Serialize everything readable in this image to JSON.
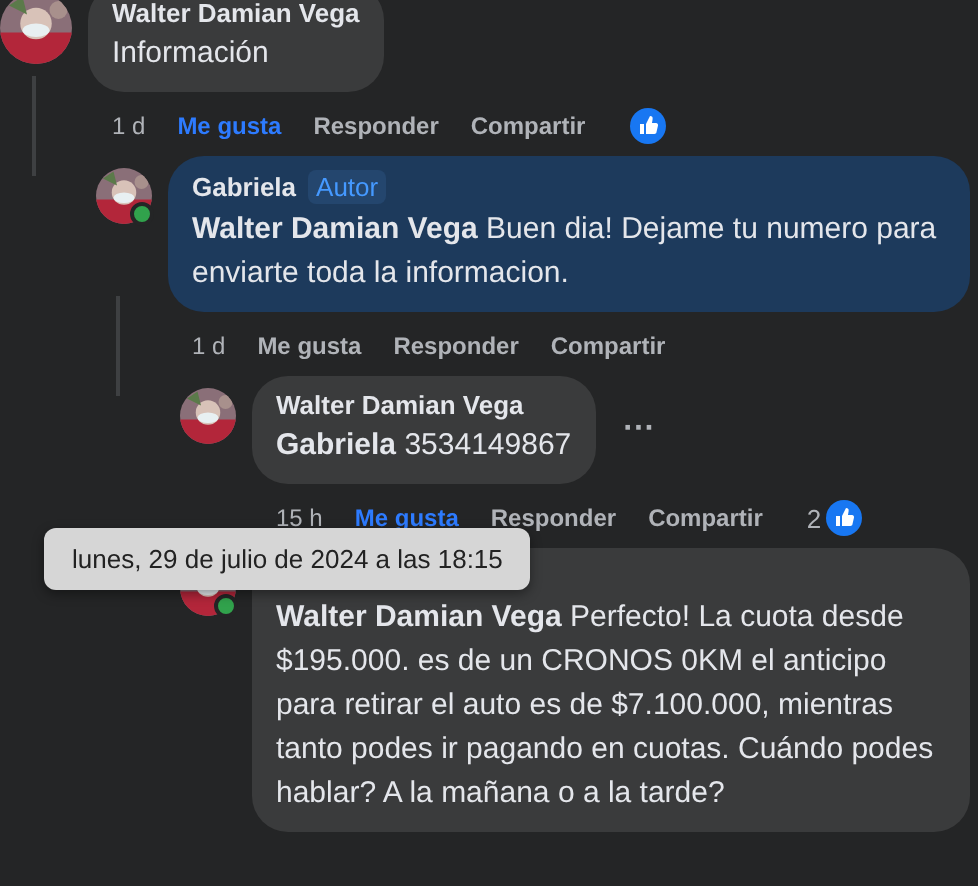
{
  "comments": [
    {
      "author": "Walter Damian Vega",
      "text": "Información",
      "time": "1 d",
      "liked": true,
      "actions": [
        "Me gusta",
        "Responder",
        "Compartir"
      ],
      "reaction_icon": true,
      "children": [
        {
          "author": "Gabriela",
          "badge": "Autor",
          "online": true,
          "mention": "Walter Damian Vega",
          "text": "Buen dia! Dejame tu numero para enviarte toda la informacion.",
          "highlighted": true,
          "time": "1 d",
          "liked": false,
          "actions": [
            "Me gusta",
            "Responder",
            "Compartir"
          ],
          "children": [
            {
              "author": "Walter Damian Vega",
              "mention": "Gabriela",
              "text": "3534149867",
              "more": "···",
              "time": "15 h",
              "liked": true,
              "actions": [
                "Me gusta",
                "Responder",
                "Compartir"
              ],
              "reaction_count": "2",
              "reaction_icon": true,
              "tooltip": "lunes, 29 de julio de 2024 a las 18:15"
            },
            {
              "online": true,
              "mention": "Walter Damian Vega",
              "text": "Perfecto! La cuota desde $195.000. es de un CRONOS 0KM el anticipo para retirar el auto es de $7.100.000, mientras tanto podes ir pagando en cuotas. Cuándo podes hablar? A la mañana o a la tarde?"
            }
          ]
        }
      ]
    }
  ]
}
